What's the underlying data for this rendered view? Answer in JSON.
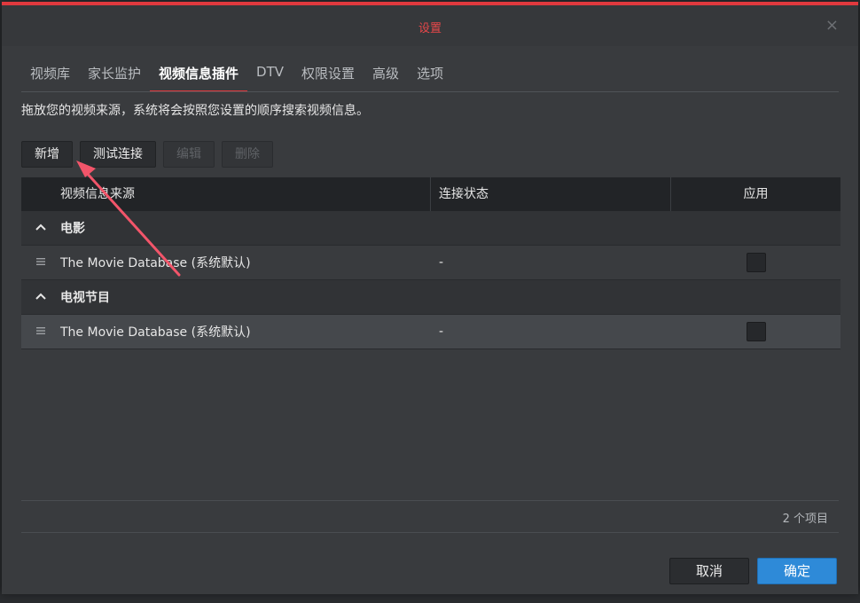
{
  "window": {
    "title": "设置",
    "close_icon": "×"
  },
  "tabs": [
    {
      "label": "视频库",
      "active": false
    },
    {
      "label": "家长监护",
      "active": false
    },
    {
      "label": "视频信息插件",
      "active": true
    },
    {
      "label": "DTV",
      "active": false
    },
    {
      "label": "权限设置",
      "active": false
    },
    {
      "label": "高级",
      "active": false
    },
    {
      "label": "选项",
      "active": false
    }
  ],
  "description": "拖放您的视频来源，系统将会按照您设置的顺序搜索视频信息。",
  "toolbar": {
    "add_label": "新增",
    "test_label": "测试连接",
    "edit_label": "编辑",
    "delete_label": "删除"
  },
  "table": {
    "headers": {
      "source": "视频信息来源",
      "status": "连接状态",
      "apply": "应用"
    },
    "groups": [
      {
        "label": "电影",
        "items": [
          {
            "name": "The Movie Database (系统默认)",
            "status": "-",
            "applied": false
          }
        ]
      },
      {
        "label": "电视节目",
        "items": [
          {
            "name": "The Movie Database (系统默认)",
            "status": "-",
            "applied": false
          }
        ]
      }
    ]
  },
  "footer": {
    "count_label": "2 个项目",
    "cancel_label": "取消",
    "ok_label": "确定"
  },
  "colors": {
    "accent_red": "#e0393e",
    "primary_blue": "#2e8ad8",
    "annotation_arrow": "#f2556a"
  },
  "icons": {
    "collapse": "chevron-up-icon",
    "drag": "drag-handle-icon",
    "close": "close-icon"
  }
}
